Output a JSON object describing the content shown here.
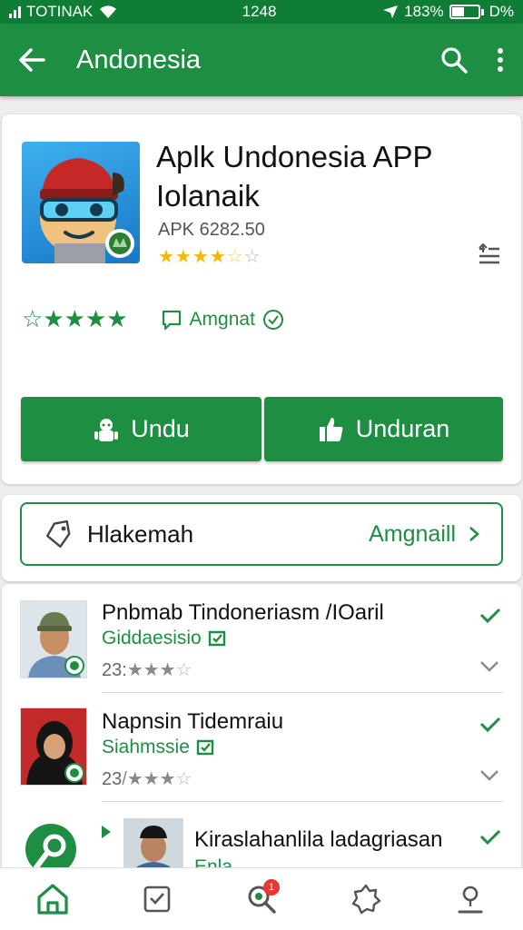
{
  "status_bar": {
    "carrier": "TOTINAK",
    "time": "1248",
    "battery": "183%",
    "extra": "D%"
  },
  "app_bar": {
    "title": "Andonesia",
    "back_icon": "arrow-left-icon",
    "search_icon": "search-icon",
    "menu_icon": "more-vert-icon"
  },
  "app": {
    "title_line1": "Aplk Undonesia APP",
    "title_line2": "Iolanaik",
    "version": "APK 6282.50",
    "rating_stars": "★★★★☆",
    "rating_value_fraction": 0.7,
    "recommend_label": "Amgnat",
    "install_button_1": "Undu",
    "install_button_2": "Unduran"
  },
  "report": {
    "label": "Hlakemah",
    "action": "Amgnaill"
  },
  "reviews": [
    {
      "name": "Pnbmab Tindoneriasm /IOaril",
      "sub": "Giddaesisio",
      "meta": "23:",
      "stars": "★★★"
    },
    {
      "name": "Napnsin Tidemraiu",
      "sub": "Siahmssie",
      "meta": "23",
      "stars": "/★★★"
    },
    {
      "name": "Kiraslahanlila ladagriasan",
      "sub": "Enla",
      "meta": "",
      "stars": ""
    }
  ],
  "bottom_nav": {
    "items": [
      "home-icon",
      "checkbox-icon",
      "search-notify-icon",
      "badge-star-icon",
      "profile-icon"
    ],
    "notify_count": "1"
  },
  "colors": {
    "primary": "#1e8e43",
    "status_bar": "#0f7d36",
    "star": "#f5b800"
  }
}
